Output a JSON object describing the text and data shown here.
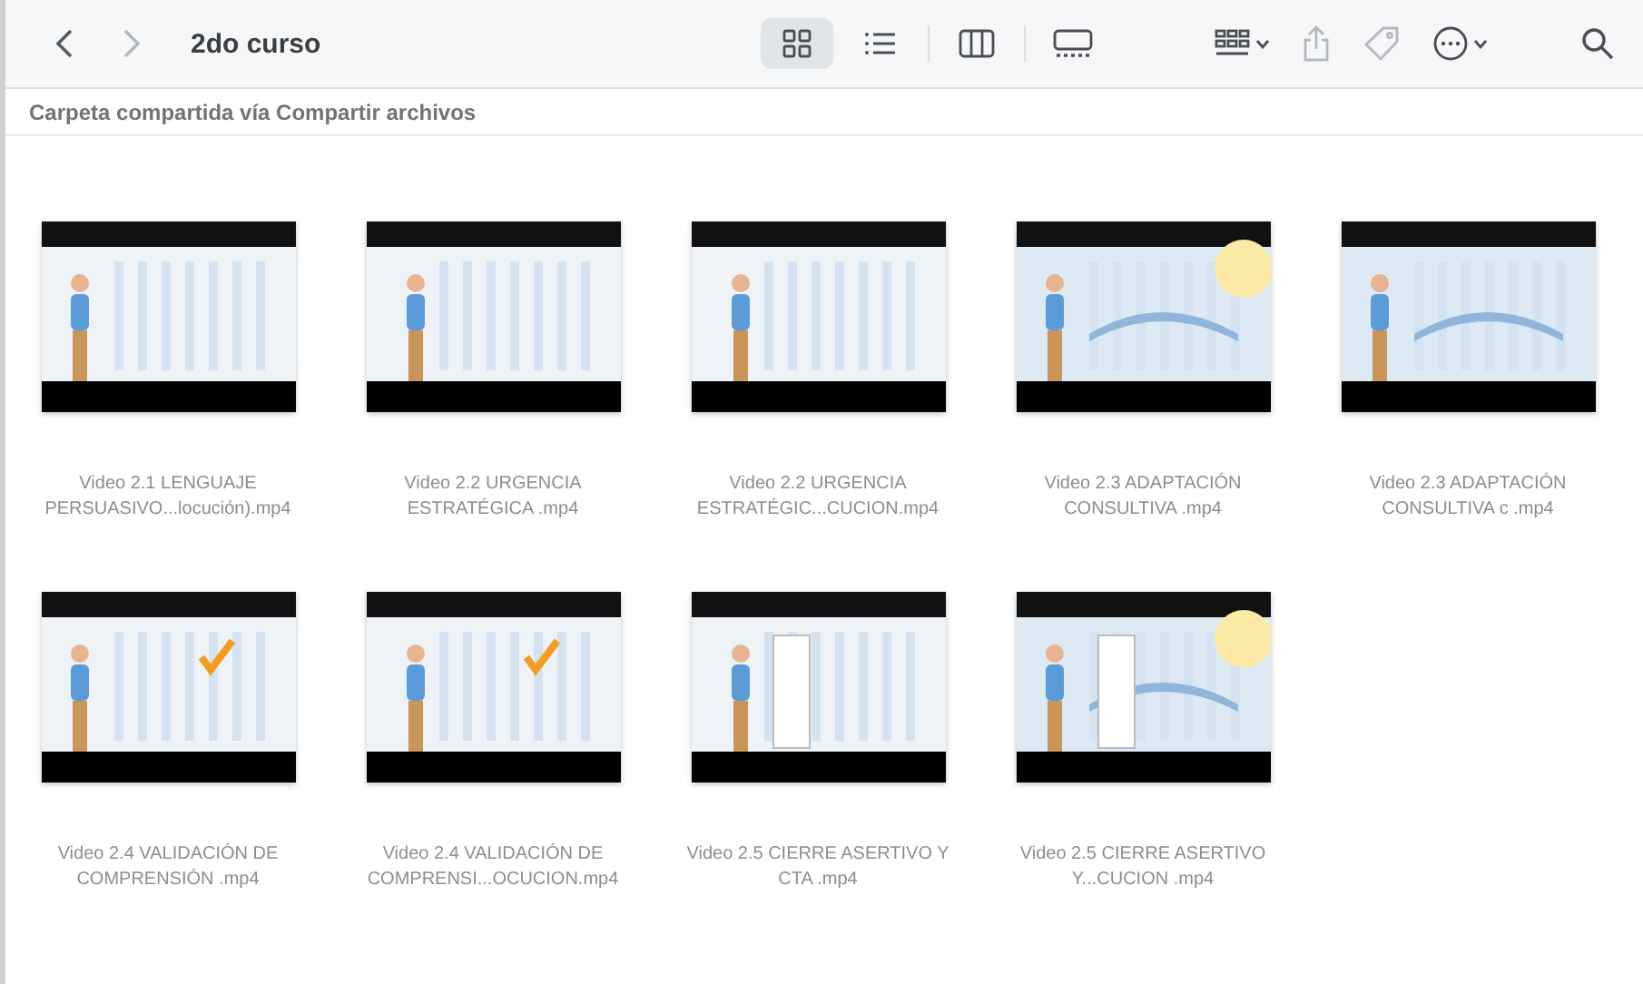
{
  "window": {
    "title": "2do curso"
  },
  "navigation": [
    {
      "kind": "back",
      "disabled": false
    },
    {
      "kind": "forward",
      "disabled": true
    }
  ],
  "views": [
    {
      "kind": "icons",
      "selected": true
    },
    {
      "kind": "list",
      "selected": false
    },
    {
      "kind": "columns",
      "selected": false
    },
    {
      "kind": "gallery",
      "selected": false
    }
  ],
  "actions": [
    {
      "kind": "group",
      "disabled": false
    },
    {
      "kind": "share",
      "disabled": true
    },
    {
      "kind": "tag",
      "disabled": true
    },
    {
      "kind": "more",
      "disabled": false
    },
    {
      "kind": "search",
      "disabled": false
    }
  ],
  "path_bar": {
    "text": "Carpeta compartida vía Compartir archivos"
  },
  "files": [
    {
      "name": "Video 2.1  LENGUAJE PERSUASIVO...locución).mp4"
    },
    {
      "name": "Video 2.2  URGENCIA ESTRATÉGICA .mp4"
    },
    {
      "name": "Video 2.2  URGENCIA ESTRATÉGIC...CUCION.mp4"
    },
    {
      "name": "Video 2.3  ADAPTACIÓN CONSULTIVA .mp4"
    },
    {
      "name": "Video 2.3  ADAPTACIÓN CONSULTIVA c .mp4"
    },
    {
      "name": "Video 2.4  VALIDACIÓN DE COMPRENSIÓN .mp4"
    },
    {
      "name": "Video 2.4  VALIDACIÓN DE COMPRENSI...OCUCION.mp4"
    },
    {
      "name": "Video 2.5  CIERRE ASERTIVO Y CTA .mp4"
    },
    {
      "name": "Video 2.5  CIERRE ASERTIVO Y...CUCION .mp4"
    }
  ]
}
